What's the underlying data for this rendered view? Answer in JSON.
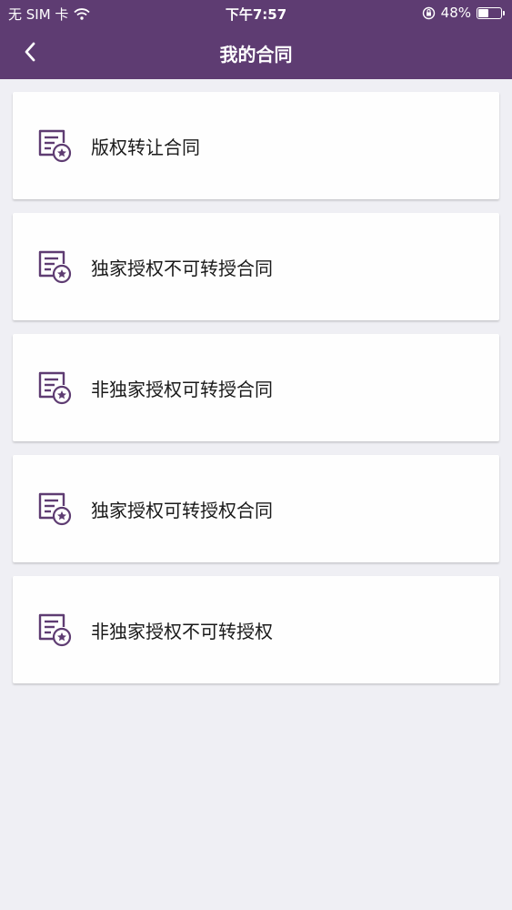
{
  "status_bar": {
    "carrier": "无 SIM 卡",
    "time": "下午7:57",
    "battery": "48%",
    "battery_level": 0.48
  },
  "nav": {
    "title": "我的合同",
    "back_icon": "chevron-left-icon"
  },
  "colors": {
    "header_bg": "#5e3c72",
    "page_bg": "#efeff4",
    "icon": "#5e3c72"
  },
  "contracts": [
    {
      "label": "版权转让合同",
      "icon": "contract-star-icon"
    },
    {
      "label": "独家授权不可转授合同",
      "icon": "contract-star-icon"
    },
    {
      "label": "非独家授权可转授合同",
      "icon": "contract-star-icon"
    },
    {
      "label": "独家授权可转授权合同",
      "icon": "contract-star-icon"
    },
    {
      "label": "非独家授权不可转授权",
      "icon": "contract-star-icon"
    }
  ]
}
